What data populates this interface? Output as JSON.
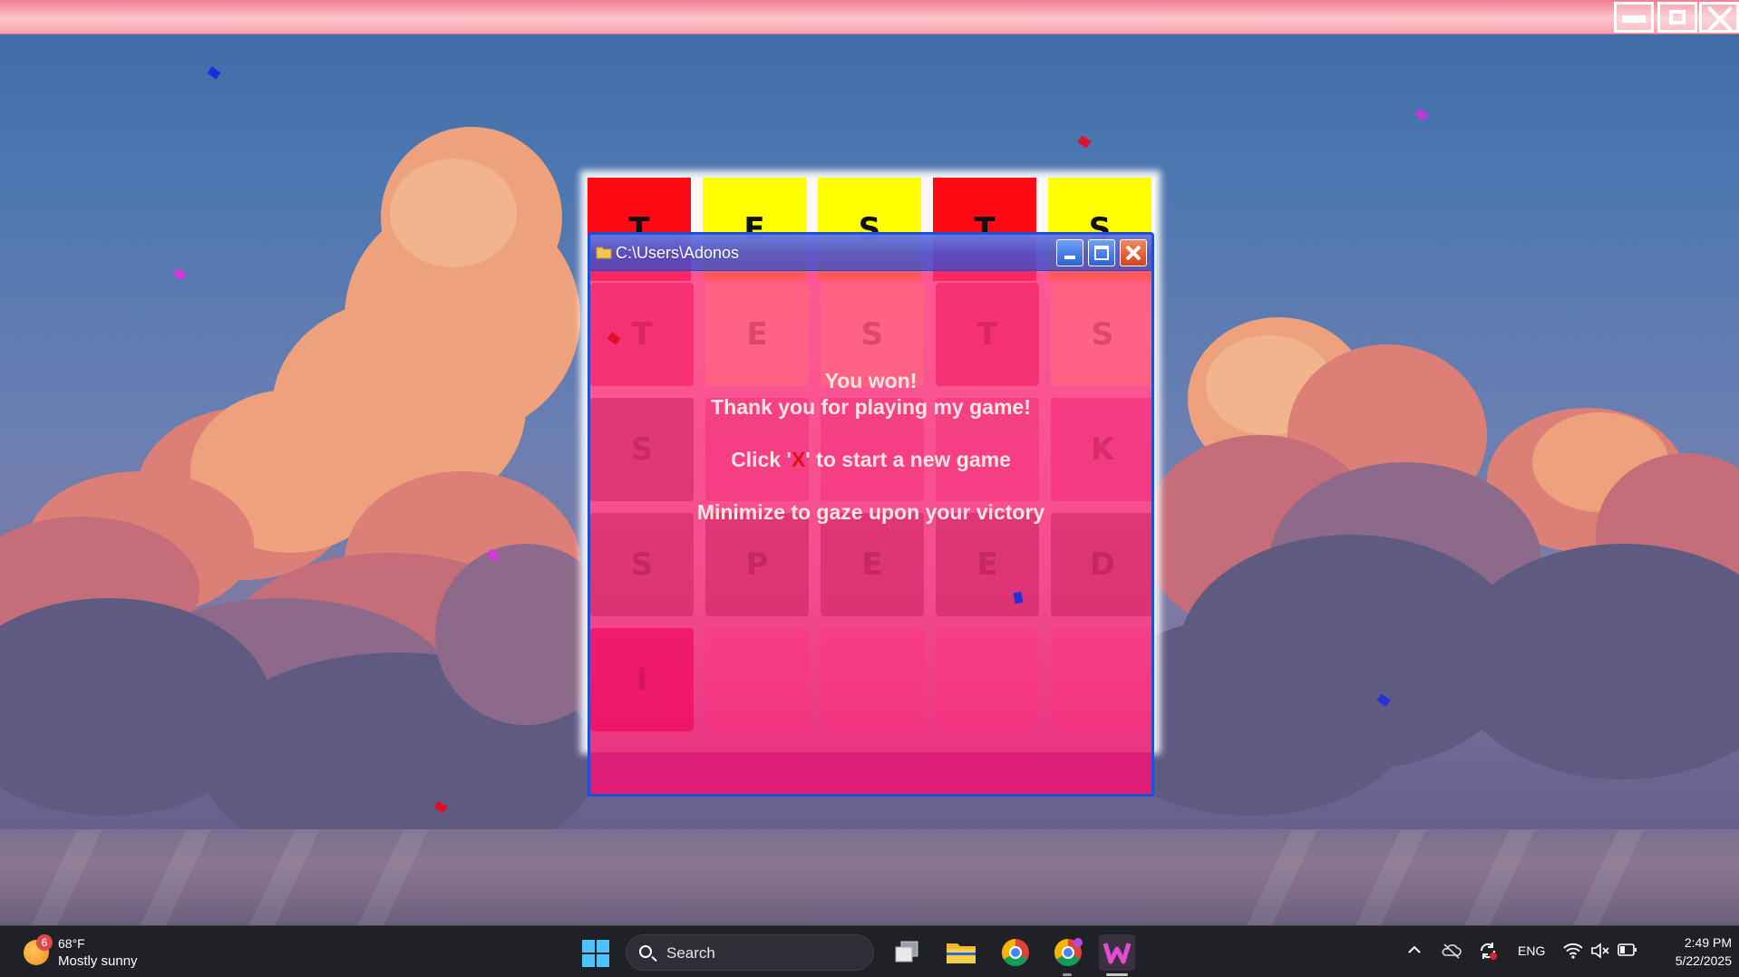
{
  "game_window": {
    "controls": [
      "minimize",
      "maximize",
      "close"
    ]
  },
  "board": {
    "top_row": [
      {
        "letter": "T",
        "color": "#ff0a14"
      },
      {
        "letter": "E",
        "color": "#ffff00"
      },
      {
        "letter": "S",
        "color": "#ffff00"
      },
      {
        "letter": "T",
        "color": "#ff0a14"
      },
      {
        "letter": "S",
        "color": "#ffff00"
      }
    ],
    "hidden_rows": [
      [
        "T",
        "E",
        "S",
        "T",
        "S"
      ],
      [
        "S",
        "",
        "",
        "",
        "K"
      ],
      [
        "S",
        "P",
        "E",
        "E",
        "D"
      ],
      [
        "I",
        "",
        "",
        "",
        ""
      ]
    ]
  },
  "explorer": {
    "title": "C:\\Users\\Adonos",
    "message": {
      "line1": "You won!",
      "line2": "Thank you for playing my game!",
      "line3_prefix": "Click '",
      "line3_x": "X",
      "line3_suffix": "' to start a new game",
      "line4": "Minimize to gaze upon your victory"
    }
  },
  "taskbar": {
    "weather": {
      "badge": "6",
      "temp": "68°F",
      "condition": "Mostly sunny"
    },
    "search_placeholder": "Search",
    "apps": [
      "windows-start",
      "task-view",
      "file-explorer",
      "chrome",
      "chrome-profile",
      "wordle-app"
    ],
    "tray": {
      "language": "ENG"
    },
    "clock": {
      "time": "2:49 PM",
      "date": "5/22/2025"
    }
  },
  "colors": {
    "accent_pink": "#ff2e78",
    "title_blue": "#1e4fd6",
    "taskbar": "#202027"
  }
}
